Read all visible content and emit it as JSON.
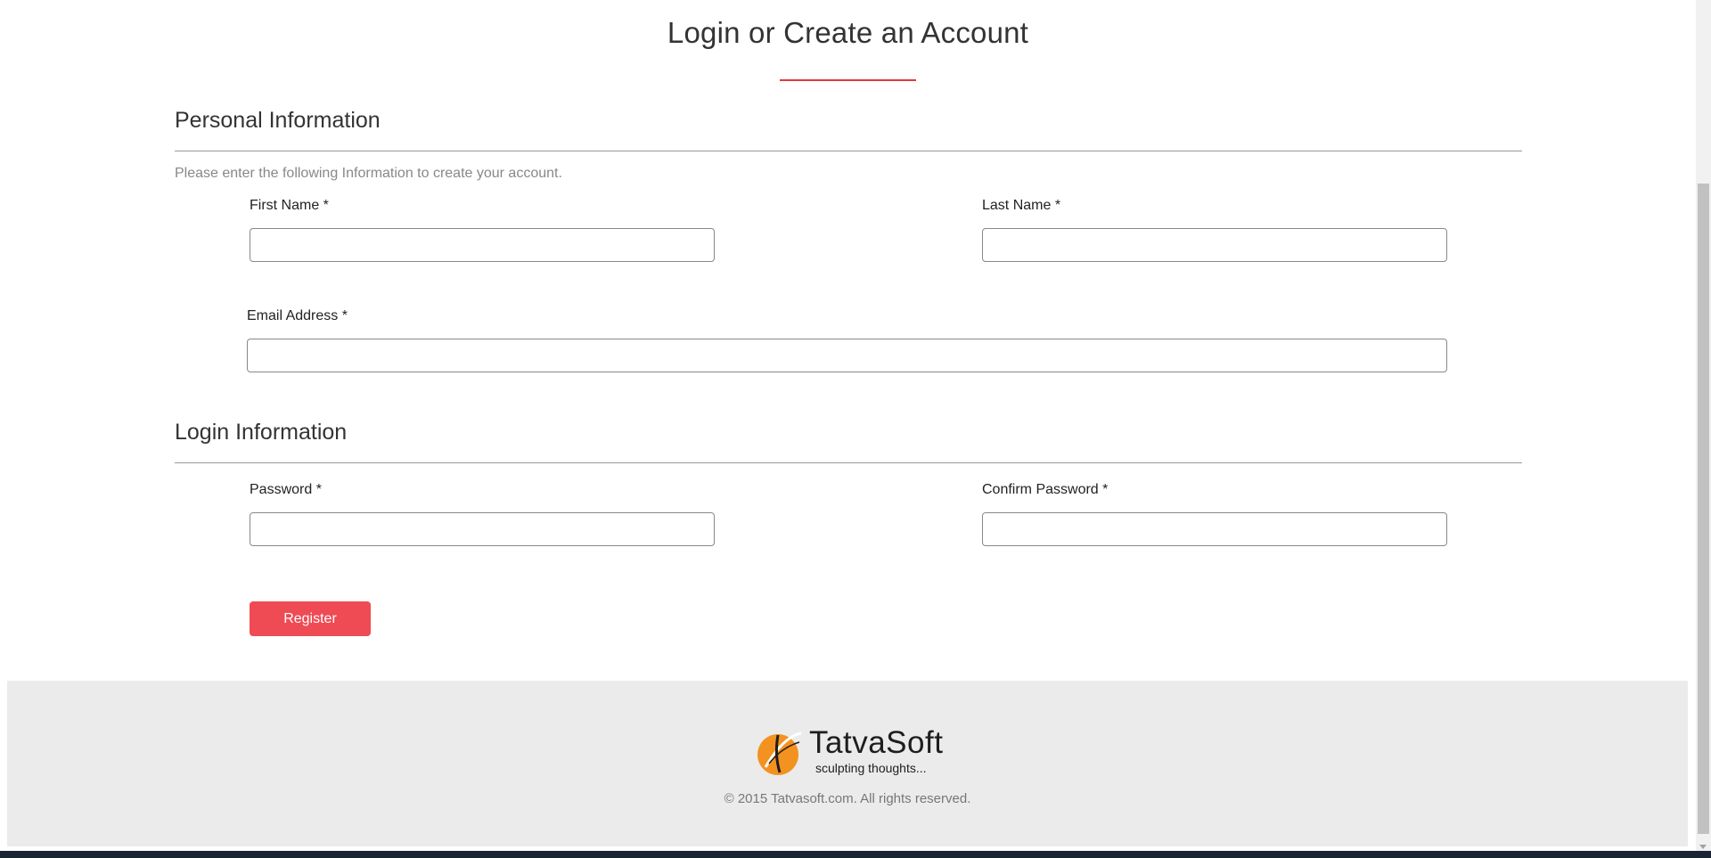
{
  "page": {
    "title": "Login or Create an Account",
    "accent_color": "#e03a3e"
  },
  "personal_section": {
    "heading": "Personal Information",
    "intro": "Please enter the following Information to create your account.",
    "first_name_label": "First Name *",
    "first_name_value": "",
    "last_name_label": "Last Name *",
    "last_name_value": "",
    "email_label": "Email Address *",
    "email_value": ""
  },
  "login_section": {
    "heading": "Login Information",
    "password_label": "Password *",
    "password_value": "",
    "confirm_password_label": "Confirm Password *",
    "confirm_password_value": ""
  },
  "actions": {
    "register_label": "Register",
    "register_color": "#ef4b54"
  },
  "footer": {
    "logo_name": "TatvaSoft",
    "logo_tagline": "sculpting thoughts...",
    "logo_icon": "tatvasoft-logo-icon",
    "copyright": "© 2015 Tatvasoft.com. All rights reserved.",
    "background_color": "#ebebeb"
  }
}
